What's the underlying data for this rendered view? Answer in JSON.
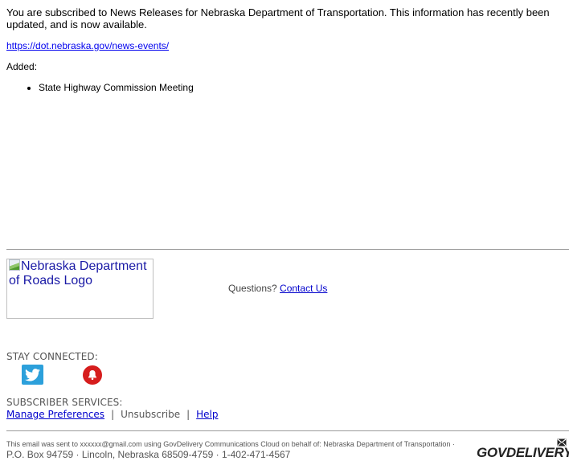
{
  "message": {
    "intro": "You are subscribed to News Releases for Nebraska Department of Transportation. This information has recently been updated, and is now available.",
    "link": "https://dot.nebraska.gov/news-events/",
    "added_label": "Added:",
    "added_items": [
      "State Highway Commission Meeting"
    ]
  },
  "footer": {
    "logo_alt": "Nebraska Department of Roads Logo",
    "questions_label": "Questions?",
    "contact_link": "Contact Us",
    "stay_connected_label": "STAY CONNECTED:",
    "social_icons": [
      "twitter-icon",
      "bell-icon"
    ],
    "subscriber_services_label": "SUBSCRIBER SERVICES:",
    "manage_preferences": "Manage Preferences",
    "separator": "|",
    "unsubscribe": "Unsubscribe",
    "help": "Help",
    "sent_to_text": "This email was sent to xxxxxx@gmail.com using GovDelivery Communications Cloud on behalf of: Nebraska Department of Transportation ·",
    "address": "P.O. Box 94759 · Lincoln, Nebraska 68509-4759 · 1-402-471-4567",
    "brand": "GOVDELIVERY"
  },
  "colors": {
    "link": "#0000cc",
    "twitter": "#2ca0db",
    "bell": "#d61d1d"
  }
}
